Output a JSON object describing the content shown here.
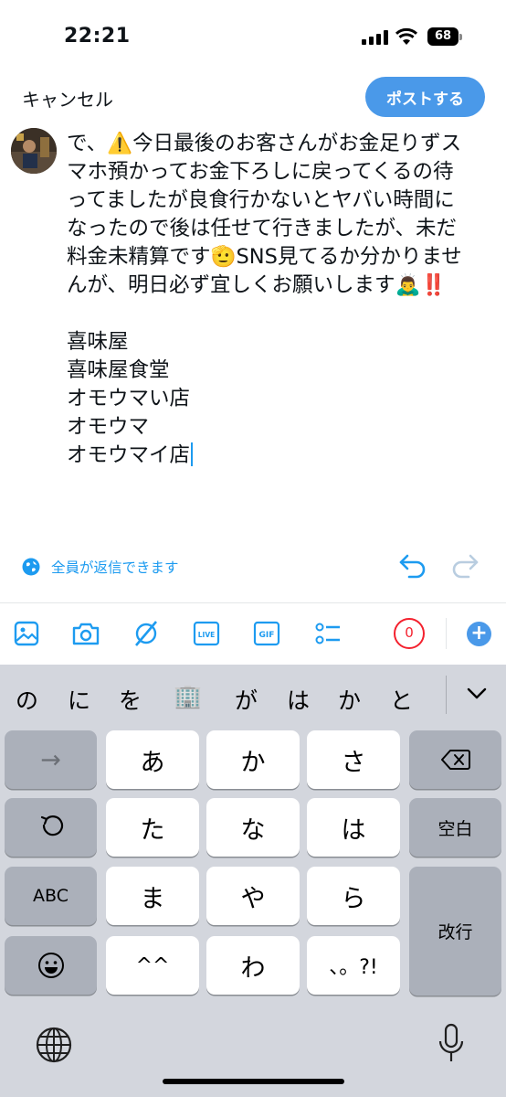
{
  "status_bar": {
    "time": "22:21",
    "battery": "68"
  },
  "header": {
    "cancel_label": "キャンセル",
    "post_label": "ポストする"
  },
  "compose": {
    "lines": [
      "で、⚠️今日最後のお客さんがお金足りずス",
      "マホ預かってお金下ろしに戻ってくるの待",
      "ってましたが良食行かないとヤバい時間に",
      "なったので後は任せて行きましたが、未だ",
      "料金未精算です🫡SNS見てるか分かりませ",
      "んが、明日必ず宜しくお願いします🙇‍♂️‼️"
    ],
    "names": [
      "喜味屋",
      "喜味屋食堂",
      "オモウマい店",
      "オモウマ",
      "オモウマイ店"
    ]
  },
  "reply_setting": {
    "label": "全員が返信できます"
  },
  "toolbar": {
    "char_counter": "0"
  },
  "keyboard": {
    "suggestions": [
      "の",
      "に",
      "を",
      "🏢",
      "が",
      "は",
      "か",
      "と"
    ],
    "row1": {
      "left_fn": "→",
      "keys": [
        "あ",
        "か",
        "さ"
      ]
    },
    "row2": {
      "keys": [
        "た",
        "な",
        "は"
      ],
      "right_fn": "空白"
    },
    "row3": {
      "left_fn": "ABC",
      "keys": [
        "ま",
        "や",
        "ら"
      ],
      "right_fn": "改行"
    },
    "row4": {
      "keys": [
        "^^",
        "わ",
        "、。?!"
      ]
    }
  },
  "colors": {
    "accent": "#1d9bf0",
    "post_button": "#4a99e9",
    "counter_red": "#f4212e",
    "keyboard_bg": "#d3d6dd"
  }
}
